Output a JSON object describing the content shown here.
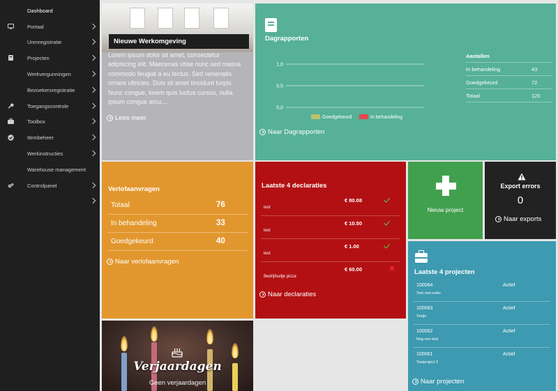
{
  "sidebar": {
    "items": [
      {
        "label": "Dashboard",
        "icon": "",
        "chevron": false
      },
      {
        "label": "Portaal",
        "icon": "monitor-icon",
        "chevron": true
      },
      {
        "label": "Urenregistratie",
        "icon": "",
        "chevron": true
      },
      {
        "label": "Projecten",
        "icon": "book-icon",
        "chevron": true
      },
      {
        "label": "Werkvergunningen",
        "icon": "",
        "chevron": true
      },
      {
        "label": "Bezoekersregistratie",
        "icon": "",
        "chevron": true
      },
      {
        "label": "Toegangscontrole",
        "icon": "key-icon",
        "chevron": true
      },
      {
        "label": "Toolbox",
        "icon": "briefcase-icon",
        "chevron": true
      },
      {
        "label": "Itembeheer",
        "icon": "check-circle-icon",
        "chevron": true
      },
      {
        "label": "Werkinstructies",
        "icon": "",
        "chevron": true
      },
      {
        "label": "Warehouse management",
        "icon": "",
        "chevron": false
      },
      {
        "label": "Controlpanel",
        "icon": "gears-icon",
        "chevron": true
      },
      {
        "label": "",
        "icon": "",
        "chevron": true
      }
    ]
  },
  "news": {
    "title": "Nieuwe Werkomgeving",
    "body": "Lorem ipsum dolor sit amet, consectetur adipiscing elit. Maecenas vitae nunc sed massa commodo feugiat a eu lectus. Sed venenatis ornare ultricies. Duis sit amet tincidunt turpis. Nunc congue, lorem quis luctus cursus, nulla ipsum congue arcu,...",
    "link": "Lees meer"
  },
  "dagrapporten": {
    "title": "Dagrapporten",
    "link": "Naar Dagrapporten",
    "table": {
      "header": "Aantallen",
      "rows": [
        {
          "label": "In behandeling",
          "value": "43"
        },
        {
          "label": "Goedgekeurd",
          "value": "72"
        },
        {
          "label": "Totaal",
          "value": "120"
        }
      ]
    }
  },
  "chart_data": {
    "type": "bar",
    "categories": [],
    "series": [
      {
        "name": "Goedgekeurd",
        "values": []
      },
      {
        "name": "In behandeling",
        "values": []
      }
    ],
    "yticks": [
      "1,0",
      "0,5",
      "0,0"
    ],
    "ylim": [
      0,
      1
    ],
    "legend": "bottom",
    "grid": true,
    "colors": {
      "Goedgekeurd": "#b7c46e",
      "In behandeling": "#e6474f"
    }
  },
  "verlof": {
    "title": "Verlofaanvragen",
    "rows": [
      {
        "label": "Totaal",
        "value": "76"
      },
      {
        "label": "In behandeling",
        "value": "33"
      },
      {
        "label": "Goedgekeurd",
        "value": "40"
      }
    ],
    "link": "Naar verlofaanvragen"
  },
  "declaraties": {
    "title": "Laatste 4 declaraties",
    "rows": [
      {
        "amount": "€ 80.08",
        "desc": "test",
        "status": "approved"
      },
      {
        "amount": "€ 10.50",
        "desc": "test",
        "status": "approved"
      },
      {
        "amount": "€ 1.00",
        "desc": "test",
        "status": "approved"
      },
      {
        "amount": "€ 60.00",
        "desc": "Bedrijfsuitje pizza",
        "status": "rejected"
      }
    ],
    "link": "Naar declaraties"
  },
  "new_project": {
    "label": "Nieuw project"
  },
  "export": {
    "title": "Export errors",
    "count": "0",
    "link": "Naar exports"
  },
  "projects": {
    "title": "Laatste 4 projecten",
    "rows": [
      {
        "number": "100064",
        "status": "Actief",
        "name": "Test met order"
      },
      {
        "number": "100063",
        "status": "Actief",
        "name": "Testje"
      },
      {
        "number": "100062",
        "status": "Actief",
        "name": "Nog een test"
      },
      {
        "number": "100061",
        "status": "Actief",
        "name": "Testproject 2"
      }
    ],
    "link": "Naar projecten"
  },
  "birthdays": {
    "title": "Verjaardagen",
    "subtitle": "Geen verjaardagen"
  },
  "colors": {
    "sidebar": "#1f1f1f",
    "teal": "#56b198",
    "orange": "#e2972e",
    "red": "#b31013",
    "green": "#41a04e",
    "blue": "#3d9ab0",
    "dark": "#222222"
  }
}
